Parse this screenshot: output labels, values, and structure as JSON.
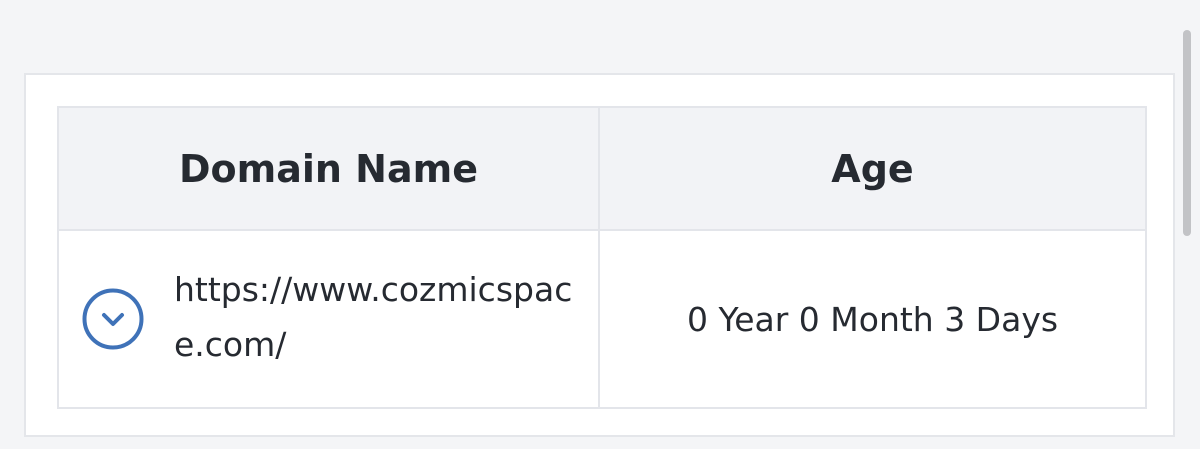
{
  "table": {
    "headers": {
      "domain": "Domain Name",
      "age": "Age"
    },
    "rows": [
      {
        "domain": "https://www.cozmicspace.com/",
        "age": "0 Year 0 Month 3 Days",
        "expand_icon": "chevron-down-circle-icon"
      }
    ]
  },
  "colors": {
    "icon_accent": "#3f72b8",
    "header_bg": "#f2f3f6",
    "border": "#e3e5ea",
    "page_bg": "#f4f5f7"
  }
}
